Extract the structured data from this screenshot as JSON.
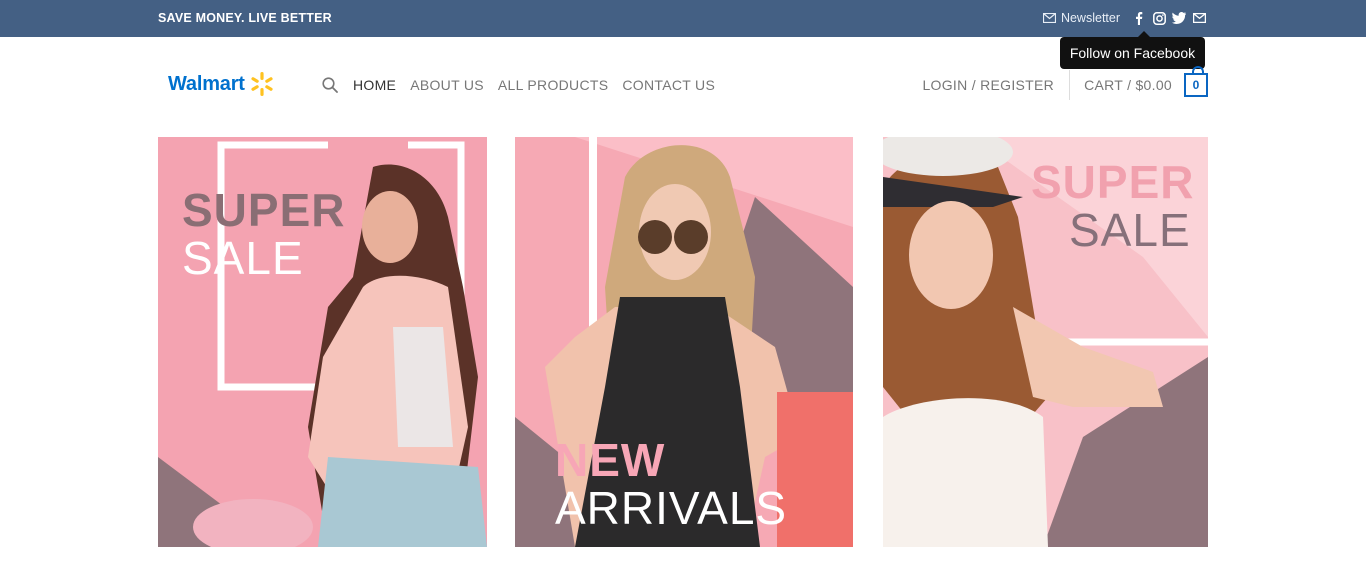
{
  "topbar": {
    "tagline": "SAVE MONEY. LIVE BETTER",
    "newsletter_label": "Newsletter",
    "social_icons": [
      "facebook-icon",
      "instagram-icon",
      "twitter-icon",
      "email-icon"
    ]
  },
  "tooltip": {
    "text": "Follow on Facebook"
  },
  "header": {
    "logo_text": "Walmart",
    "nav": [
      {
        "label": "HOME",
        "active": true
      },
      {
        "label": "ABOUT US",
        "active": false
      },
      {
        "label": "ALL PRODUCTS",
        "active": false
      },
      {
        "label": "CONTACT US",
        "active": false
      }
    ],
    "login_label": "LOGIN / REGISTER",
    "cart_label": "CART / $0.00",
    "cart_count": "0"
  },
  "banners": [
    {
      "line1": "SUPER",
      "line2": "SALE"
    },
    {
      "line1": "NEW",
      "line2": "ARRIVALS"
    },
    {
      "line1": "SUPER",
      "line2": "SALE"
    }
  ],
  "colors": {
    "topbar": "#446084",
    "accent": "#0a66c2",
    "logo_blue": "#0071ce",
    "logo_spark": "#ffc220"
  }
}
